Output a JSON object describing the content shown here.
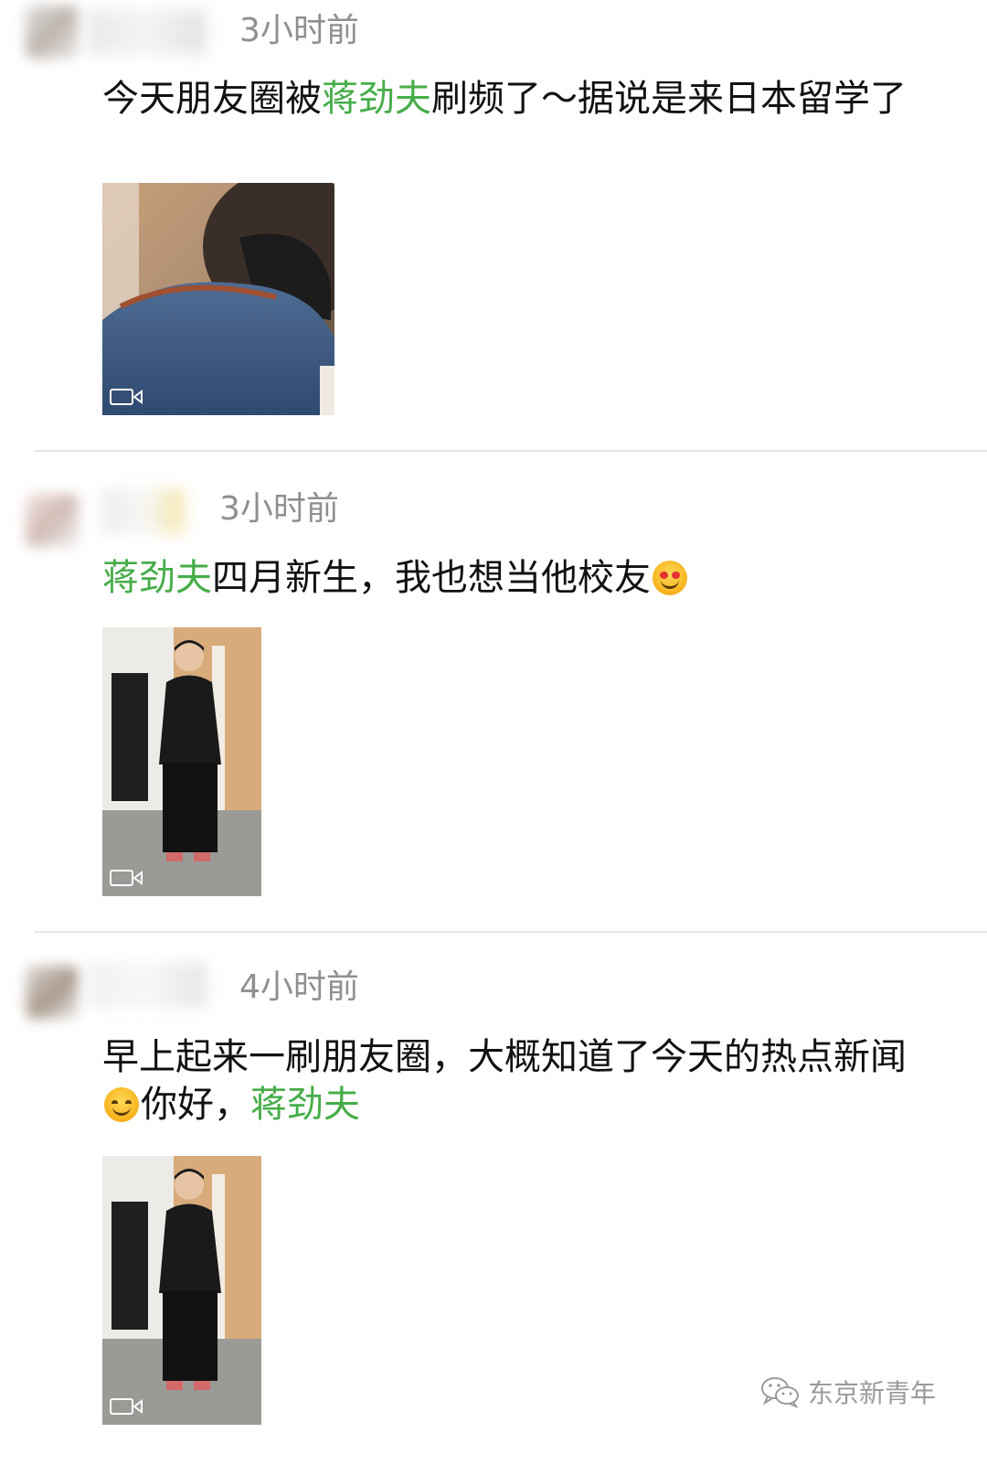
{
  "feed": {
    "posts": [
      {
        "timestamp": "3小时前",
        "text_parts": [
          "今天朋友圈被",
          "蒋劲夫",
          "刷频了～据说是来日本留学了"
        ],
        "media": "video"
      },
      {
        "timestamp": "3小时前",
        "text_parts": [
          "蒋劲夫",
          "四月新生，我也想当他校友"
        ],
        "emoji": "heart-eyes-face-icon",
        "media": "video"
      },
      {
        "timestamp": "4小时前",
        "text_parts": [
          "早上起来一刷朋友圈，大概知道了今天的热点新闻",
          "你好，",
          "蒋劲夫"
        ],
        "emoji": "smiling-face-icon",
        "media": "video"
      }
    ]
  },
  "watermark": {
    "text": "东京新青年",
    "icon": "wechat-icon"
  },
  "colors": {
    "name_link": "#46ad49",
    "timestamp": "#8f8f8f"
  }
}
